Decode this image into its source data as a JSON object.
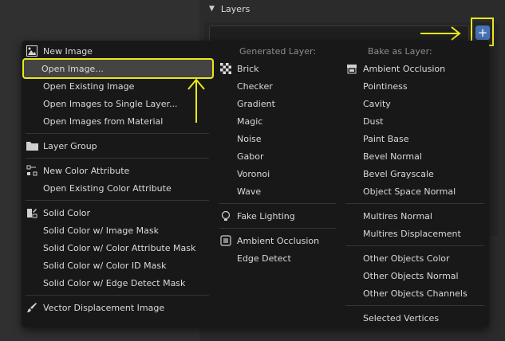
{
  "panel": {
    "title": "Layers",
    "add_button_label": "+"
  },
  "menu": {
    "col1": {
      "items": [
        {
          "label": "New Image",
          "icon": "image-icon"
        },
        {
          "label": "Open Image...",
          "icon": ""
        },
        {
          "label": "Open Existing Image",
          "icon": ""
        },
        {
          "label": "Open Images to Single Layer...",
          "icon": ""
        },
        {
          "label": "Open Images from Material",
          "icon": ""
        },
        {
          "label": "Layer Group",
          "icon": "folder-icon"
        },
        {
          "label": "New Color Attribute",
          "icon": "vertex-color-icon"
        },
        {
          "label": "Open Existing Color Attribute",
          "icon": ""
        },
        {
          "label": "Solid Color",
          "icon": "solid-color-icon"
        },
        {
          "label": "Solid Color w/ Image Mask",
          "icon": ""
        },
        {
          "label": "Solid Color w/ Color Attribute Mask",
          "icon": ""
        },
        {
          "label": "Solid Color w/ Color ID Mask",
          "icon": ""
        },
        {
          "label": "Solid Color w/ Edge Detect Mask",
          "icon": ""
        },
        {
          "label": "Vector Displacement Image",
          "icon": "brush-icon"
        }
      ]
    },
    "col2": {
      "header": "Generated Layer:",
      "items": [
        {
          "label": "Brick",
          "icon": "checker-icon"
        },
        {
          "label": "Checker",
          "icon": ""
        },
        {
          "label": "Gradient",
          "icon": ""
        },
        {
          "label": "Magic",
          "icon": ""
        },
        {
          "label": "Noise",
          "icon": ""
        },
        {
          "label": "Gabor",
          "icon": ""
        },
        {
          "label": "Voronoi",
          "icon": ""
        },
        {
          "label": "Wave",
          "icon": ""
        },
        {
          "label": "Fake Lighting",
          "icon": "lightbulb-icon"
        },
        {
          "label": "Ambient Occlusion",
          "icon": "cube-icon"
        },
        {
          "label": "Edge Detect",
          "icon": ""
        }
      ]
    },
    "col3": {
      "header": "Bake as Layer:",
      "items": [
        {
          "label": "Ambient Occlusion",
          "icon": "render-icon"
        },
        {
          "label": "Pointiness",
          "icon": ""
        },
        {
          "label": "Cavity",
          "icon": ""
        },
        {
          "label": "Dust",
          "icon": ""
        },
        {
          "label": "Paint Base",
          "icon": ""
        },
        {
          "label": "Bevel Normal",
          "icon": ""
        },
        {
          "label": "Bevel Grayscale",
          "icon": ""
        },
        {
          "label": "Object Space Normal",
          "icon": ""
        },
        {
          "label": "Multires Normal",
          "icon": ""
        },
        {
          "label": "Multires Displacement",
          "icon": ""
        },
        {
          "label": "Other Objects Color",
          "icon": ""
        },
        {
          "label": "Other Objects Normal",
          "icon": ""
        },
        {
          "label": "Other Objects Channels",
          "icon": ""
        },
        {
          "label": "Selected Vertices",
          "icon": ""
        }
      ]
    }
  },
  "colors": {
    "annotation": "#e8e91a",
    "accent": "#4772b3",
    "highlight": "#444444"
  }
}
